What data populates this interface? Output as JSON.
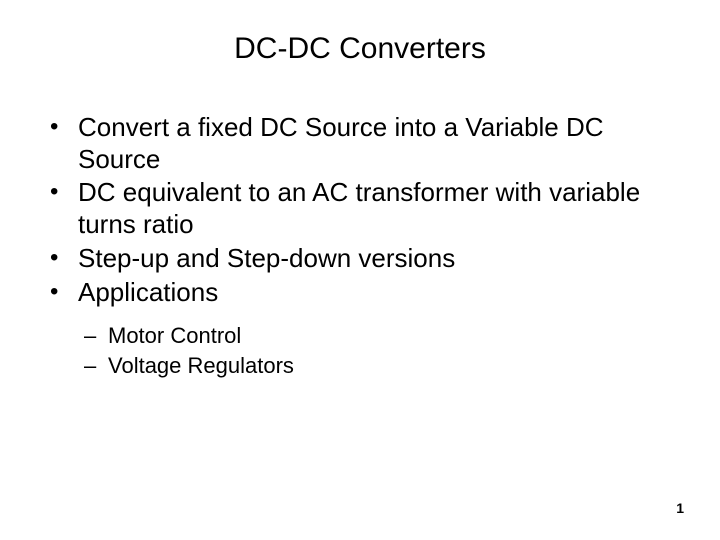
{
  "title": "DC-DC Converters",
  "bullets": [
    "Convert a fixed DC Source into a Variable DC Source",
    "DC equivalent to an AC transformer with variable turns ratio",
    "Step-up and Step-down versions",
    "Applications"
  ],
  "sub_bullets": [
    "Motor Control",
    "Voltage Regulators"
  ],
  "page_number": "1"
}
